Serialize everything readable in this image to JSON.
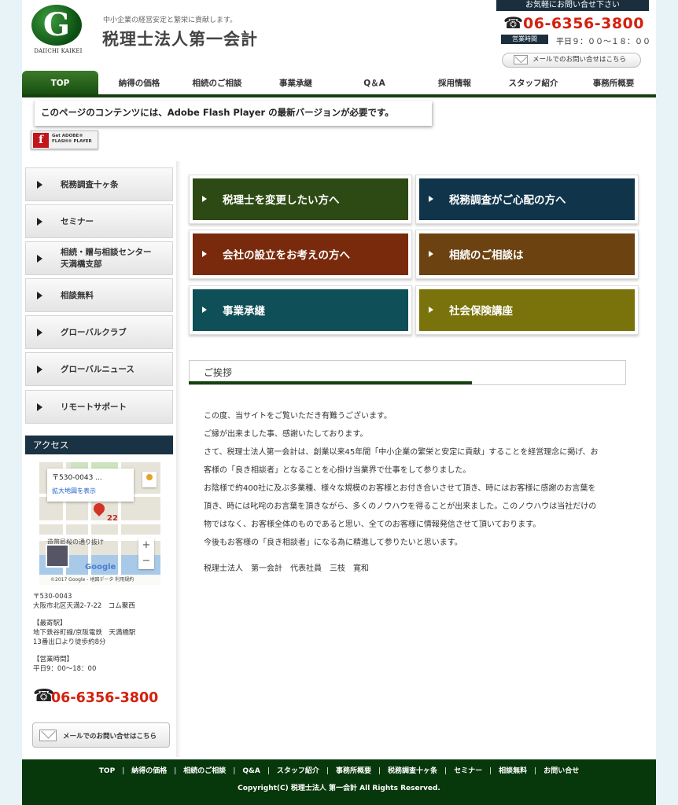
{
  "header": {
    "logo_letter": "G",
    "logo_sub": "DAIICHI KAIKEI",
    "tagline": "中小企業の経営安定と繁栄に貢献します。",
    "site_title": "税理士法人第一会計",
    "contact_heading": "お気軽にお問い合せ下さい",
    "phone": "06-6356-3800",
    "hours_label": "営業時間",
    "hours": "平日９：００～１８：００",
    "mail_button": "メールでのお問い合せはこちら"
  },
  "nav": {
    "items": [
      "TOP",
      "納得の価格",
      "相続のご相談",
      "事業承継",
      "Q＆A",
      "採用情報",
      "スタッフ紹介",
      "事務所概要"
    ],
    "active": "TOP"
  },
  "flash": {
    "notice": "このページのコンテンツには、Adobe Flash Player の最新バージョンが必要です。",
    "badge_letter": "f",
    "badge_line1": "Get ADOBE®",
    "badge_line2": "FLASH® PLAYER"
  },
  "sidebar": {
    "items": [
      {
        "label": "税務調査十ヶ条"
      },
      {
        "label": "セミナー"
      },
      {
        "label": "相続・贈与相談センター",
        "label2": "天満橋支部"
      },
      {
        "label": "相談無料"
      },
      {
        "label": "グローバルクラブ"
      },
      {
        "label": "グローバルニュース"
      },
      {
        "label": "リモートサポート"
      }
    ],
    "access_heading": "アクセス",
    "map": {
      "popup_title": "〒530-0043 ...",
      "popup_link": "拡大地図を表示",
      "marker_label": "22",
      "road_label": "造幣局桜の通り抜け",
      "google": "Google",
      "copyright": "©2017 Google - 地図データ  利用規約",
      "zoom_in": "+",
      "zoom_out": "−"
    },
    "address": {
      "postal": "〒530-0043",
      "street": "大阪市北区天満2-7-22　コム聚西",
      "station_heading": "【最寄駅】",
      "station_line1": "地下鉄谷町線/京阪電鉄　天満橋駅",
      "station_line2": "13番出口より徒歩約8分",
      "hours_heading": "【営業時間】",
      "hours": "平日9：00～18：00"
    },
    "phone": "06-6356-3800",
    "mail_button": "メールでのお問い合せはこちら"
  },
  "tiles": [
    {
      "label": "税理士を変更したい方へ",
      "color": "#2e4a14"
    },
    {
      "label": "税務調査がご心配の方へ",
      "color": "#10344a"
    },
    {
      "label": "会社の設立をお考えの方へ",
      "color": "#7a2a0c"
    },
    {
      "label": "相続のご相談は",
      "color": "#6b4210"
    },
    {
      "label": "事業承継",
      "color": "#0f4f58"
    },
    {
      "label": "社会保険講座",
      "color": "#7a730b"
    }
  ],
  "greeting": {
    "heading": "ご挨拶",
    "paragraphs": [
      "この度、当サイトをご覧いただき有難うございます。",
      "ご縁が出来ました事、感謝いたしております。",
      "さて、税理士法人第一会計は、創業以来45年間「中小企業の繁栄と安定に貢献」することを経営理念に掲げ、お",
      "客様の「良き相談者」となることを心掛け当業界で仕事をして参りました。",
      "お陰様で約400社に及ぶ多業種、様々な規模のお客様とお付き合いさせて頂き、時にはお客様に感謝のお言葉を",
      "頂き、時には叱咤のお言葉を頂きながら、多くのノウハウを得ることが出来ました。このノウハウは当社だけの",
      "物ではなく、お客様全体のものであると思い、全てのお客様に情報発信させて頂いております。",
      "今後もお客様の「良き相談者」になる為に精進して参りたいと思います。"
    ],
    "signature": "税理士法人　第一会計　代表社員　三枝　寛和"
  },
  "footer": {
    "links": [
      "TOP",
      "納得の価格",
      "相続のご相談",
      "Q&A",
      "スタッフ紹介",
      "事務所概要",
      "税務調査十ヶ条",
      "セミナー",
      "相談無料",
      "お問い合せ"
    ],
    "copyright": "Copyright(C) 税理士法人 第一会計 All Rights Reserved."
  },
  "colors": {
    "brand_green": "#16410f",
    "footer_bg": "#07380b",
    "phone_red": "#d4210f",
    "navy": "#1a2e3d"
  }
}
